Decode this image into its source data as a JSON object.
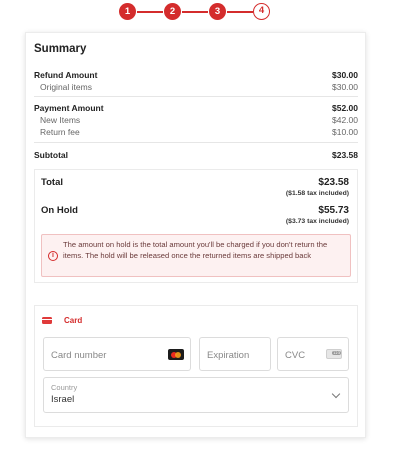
{
  "stepper": {
    "steps": [
      {
        "label": "1",
        "state": "done"
      },
      {
        "label": "2",
        "state": "done"
      },
      {
        "label": "3",
        "state": "done"
      },
      {
        "label": "4",
        "state": "current"
      }
    ],
    "accent_color": "#d42c2c"
  },
  "summary": {
    "title": "Summary",
    "refund": {
      "label": "Refund Amount",
      "amount": "$30.00",
      "items": [
        {
          "label": "Original items",
          "amount": "$30.00"
        }
      ]
    },
    "payment": {
      "label": "Payment Amount",
      "amount": "$52.00",
      "items": [
        {
          "label": "New Items",
          "amount": "$42.00"
        },
        {
          "label": "Return fee",
          "amount": "$10.00"
        }
      ]
    },
    "subtotal": {
      "label": "Subtotal",
      "amount": "$23.58"
    }
  },
  "totals": {
    "total": {
      "label": "Total",
      "amount": "$23.58",
      "tax": "($1.58 tax included)"
    },
    "on_hold": {
      "label": "On Hold",
      "amount": "$55.73",
      "tax": "($3.73 tax included)"
    },
    "alert": {
      "icon": "info-circle-icon",
      "text": "The amount on hold is the total amount you'll be charged if you don't return the items. The hold will be released once the returned items are shipped back"
    }
  },
  "payment_form": {
    "method_tab": {
      "label": "Card",
      "icon": "credit-card-icon"
    },
    "card_number": {
      "placeholder": "Card number",
      "icon": "mastercard-icon"
    },
    "expiration": {
      "placeholder": "Expiration"
    },
    "cvc": {
      "placeholder": "CVC",
      "icon": "cvc-card-icon"
    },
    "country": {
      "label": "Country",
      "value": "Israel",
      "icon": "chevron-down-icon"
    }
  }
}
